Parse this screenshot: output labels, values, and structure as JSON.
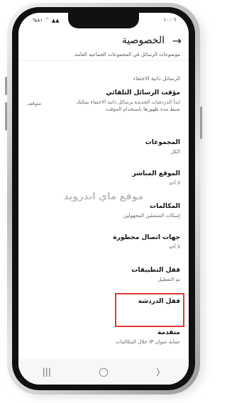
{
  "status_bar": {
    "time": "١٠:٠٦",
    "battery": "%٨١",
    "signal": "▲▲",
    "wifi": "⌔"
  },
  "header": {
    "title": "الخصوصية",
    "back_icon": "arrow-right-icon"
  },
  "clipped_text": "موضوعات الرسائل في المجموعات الجماعية العامة.",
  "section_label": "الرسائل ذاتية الاختفاء",
  "settings": [
    {
      "title": "مؤقت الرسائل التلقائي",
      "subtitle": "ابدأ الدردشات الجديدة برسائل ذاتية الاختفاء يمكنك ضبط مدة ظهورها باستخدام المؤقت",
      "value": "متوقف"
    },
    {
      "title": "المجموعات",
      "subtitle": "الكل"
    },
    {
      "title": "الموقع المباشر",
      "subtitle": "لا أحد"
    },
    {
      "title": "المكالمات",
      "subtitle": "إسكات المتصلين المجهولين"
    },
    {
      "title": "جهات اتصال محظورة",
      "subtitle": "لا أحد"
    },
    {
      "title": "قفل التطبيقات",
      "subtitle": "تم التعطيل"
    },
    {
      "title": "قفل الدردشة"
    },
    {
      "title": "متقدمة",
      "subtitle": "حماية عنوان IP خلال المكالمات"
    }
  ],
  "watermark": "موقع ماي اندرويد",
  "highlight_color": "#e53935",
  "nav": {
    "recents": "|||",
    "home": "◯",
    "back": "〉"
  }
}
